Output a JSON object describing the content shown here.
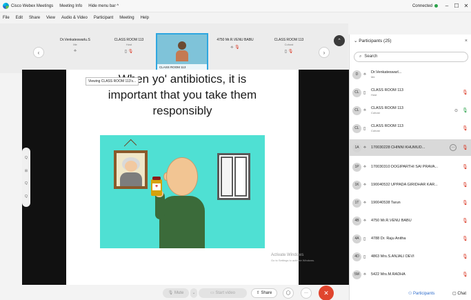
{
  "titlebar": {
    "app_title": "Cisco Webex Meetings",
    "meeting_info": "Meeting Info",
    "hide_menu": "Hide menu bar ^",
    "status": "Connected",
    "minimize": "–",
    "maximize": "☐",
    "close": "✕"
  },
  "menubar": {
    "items": [
      "File",
      "Edit",
      "Share",
      "View",
      "Audio & Video",
      "Participant",
      "Meeting",
      "Help"
    ]
  },
  "strip": {
    "prev": "‹",
    "next": "›",
    "collapse": "⌃",
    "tiles": [
      {
        "name": "Dr.Venkateswarlu.S",
        "role": "Me",
        "icons": "⟡"
      },
      {
        "name": "CLASS ROOM 113",
        "role": "Host",
        "icons": "▯"
      },
      {
        "name": "CLASS ROOM 113",
        "role": "",
        "icons": ""
      },
      {
        "name": "4750 Mr.R.VENU BABU",
        "role": "",
        "icons": "⟡"
      },
      {
        "name": "CLASS ROOM 113",
        "role": "Cohost",
        "icons": "▯"
      }
    ],
    "active_caption": "CLASS ROOM 113"
  },
  "slide": {
    "title_line1": "When yo' antibiotics, it is",
    "title_line2": "important that you take them",
    "title_line3": "responsibly",
    "viewing_tip": "Viewing CLASS ROOM 113's...",
    "bottle_label": "+",
    "watermark_title": "Activate Windows",
    "watermark_sub": "Go to Settings to activate Windows."
  },
  "side_handle": [
    "Q",
    "⊞",
    "Q",
    "Q"
  ],
  "controls": {
    "mute": "Mute",
    "caret": "⌄",
    "start_video": "Start video",
    "share": "Share",
    "record_icon": "◯",
    "more": "···",
    "leave": "✕"
  },
  "panel": {
    "title": "Participants (25)",
    "close": "×",
    "search_placeholder": "Search",
    "participants": [
      {
        "initials": "D",
        "name": "Dr.Venkateswarl...",
        "sub": "Me",
        "mic": ""
      },
      {
        "initials": "CL",
        "name": "CLASS ROOM 113",
        "sub": "Host",
        "mic": "🎙"
      },
      {
        "initials": "CL",
        "name": "CLASS ROOM 113",
        "sub": "Cohost",
        "mic": "🎙"
      },
      {
        "initials": "CL",
        "name": "CLASS ROOM 113",
        "sub": "Cohost",
        "mic": "🎙"
      },
      {
        "initials": "1A",
        "name": "170030228 CHINNI KHUMUD...",
        "sub": "",
        "mic": "🎙"
      },
      {
        "initials": "1P",
        "name": "170030310 DOGIPARTHI SAI PRAVA...",
        "sub": "",
        "mic": "🎙"
      },
      {
        "initials": "1K",
        "name": "190040532 UPPADA GIRIDHAR KAR...",
        "sub": "",
        "mic": "🎙"
      },
      {
        "initials": "1T",
        "name": "190040538 Tarun",
        "sub": "",
        "mic": "🎙"
      },
      {
        "initials": "4B",
        "name": "4750 Mr.R.VENU BABU",
        "sub": "",
        "mic": "🎙"
      },
      {
        "initials": "4A",
        "name": "4788 Dr. Raju Anitha",
        "sub": "",
        "mic": "🎙"
      },
      {
        "initials": "4D",
        "name": "4863 Mrs.S.ANJALI DEVI",
        "sub": "",
        "mic": "🎙"
      },
      {
        "initials": "5M",
        "name": "5422 Mrs.M.RADHA",
        "sub": "",
        "mic": "🎙"
      }
    ]
  },
  "footer": {
    "participants_label": "Participants",
    "chat_label": "Chat"
  },
  "colors": {
    "accent": "#2d6ccb",
    "mute_red": "#d9331f",
    "leave_red": "#e0452e",
    "scene_teal": "#4fe0d3"
  }
}
